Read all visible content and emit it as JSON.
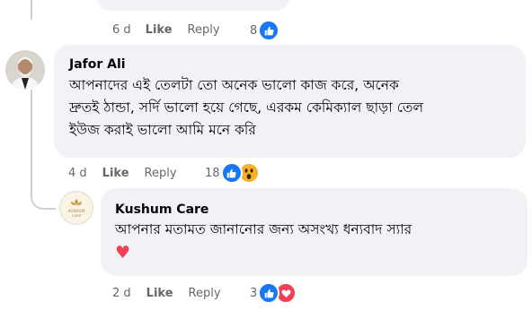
{
  "top_comment": {
    "time": "6 d",
    "like_label": "Like",
    "reply_label": "Reply",
    "reaction_count": "8"
  },
  "comment1": {
    "author": "Jafor Ali",
    "lines": [
      "আপনাদের এই তেলটা তো অনেক ভালো কাজ করে, অনেক",
      "দ্রুতই ঠান্ডা, সর্দি ভালো হয়ে গেছে, এরকম কেমিক্যাল ছাড়া তেল",
      "ইউজ করাই ভালো আমি মনে করি"
    ],
    "time": "4 d",
    "like_label": "Like",
    "reply_label": "Reply",
    "reaction_count": "18"
  },
  "reply1": {
    "author": "Kushum Care",
    "avatar_text": "KUSHUM CARE",
    "text": "আপনার মতামত জানানোর জন্য অসংখ্য ধন্যবাদ স্যার",
    "emoji": "♥",
    "time": "2 d",
    "like_label": "Like",
    "reply_label": "Reply",
    "reaction_count": "3"
  },
  "colors": {
    "like_blue": "#1877f2",
    "love_red": "#f33e58",
    "wow_yellow": "#f7b125",
    "bubble_bg": "#f0f2f5"
  }
}
